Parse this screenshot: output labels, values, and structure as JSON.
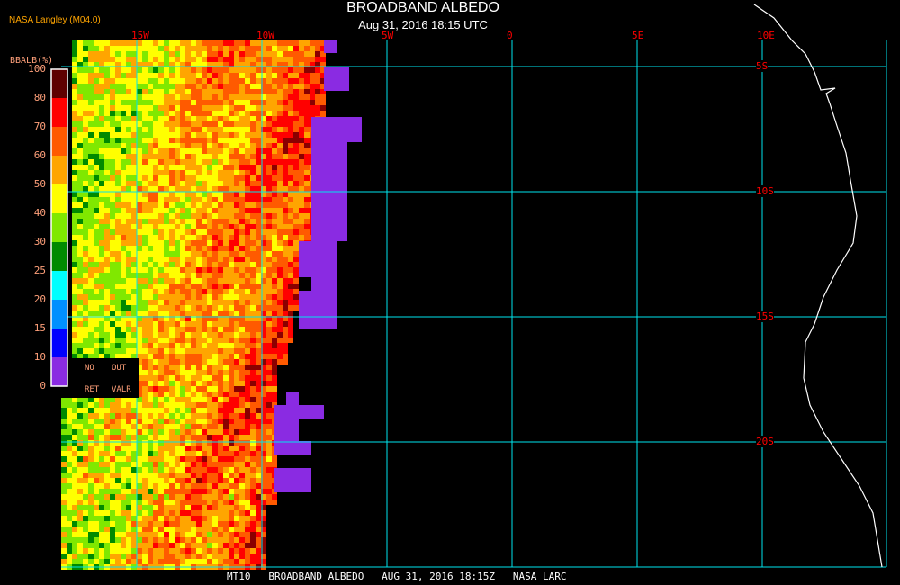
{
  "header": {
    "title": "BROADBAND ALBEDO",
    "subtitle": "Aug 31, 2016 18:15 UTC",
    "credit": "NASA Langley (M04.0)"
  },
  "legend": {
    "title": "BBALB(%)",
    "labels": [
      "100",
      "80",
      "70",
      "60",
      "50",
      "40",
      "30",
      "25",
      "20",
      "15",
      "10",
      "0"
    ],
    "colors": [
      "#5e0000",
      "#ff0000",
      "#ff5a00",
      "#ffa500",
      "#ffff00",
      "#80e800",
      "#008a00",
      "#00ffff",
      "#0090ff",
      "#0000ff",
      "#8a2be2"
    ],
    "no_ret": [
      "NO",
      "RET"
    ],
    "out_valr": [
      "OUT",
      "VALR"
    ]
  },
  "map": {
    "lon_labels": [
      "15W",
      "10W",
      "5W",
      "0",
      "5E",
      "10E"
    ],
    "lat_labels": [
      "5S",
      "10S",
      "15S",
      "20S"
    ],
    "grid_color": "#00e5ee",
    "label_color": "#ff0000"
  },
  "footer": "MT10   BROADBAND ALBEDO   AUG 31, 2016 18:15Z   NASA LARC"
}
